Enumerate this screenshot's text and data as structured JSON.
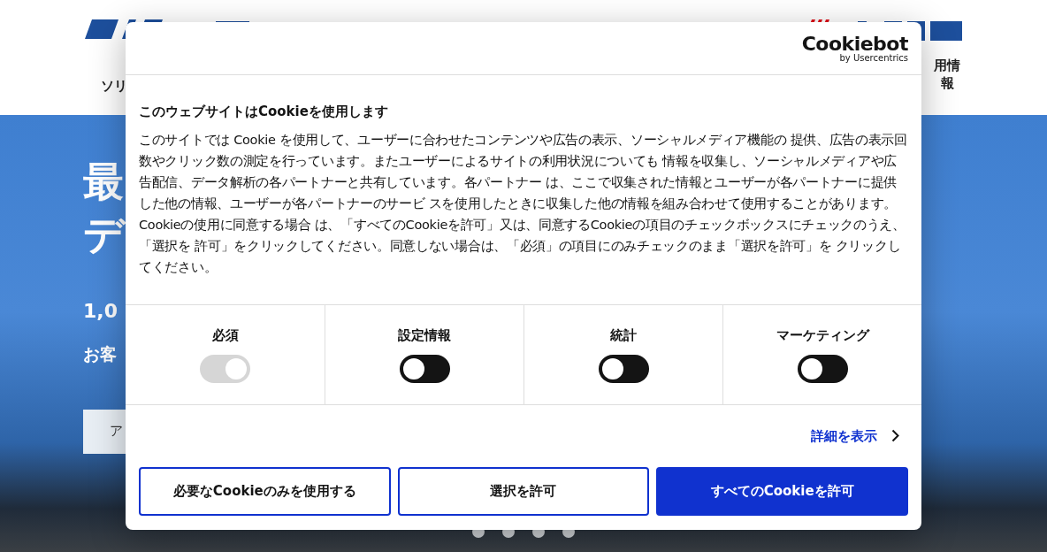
{
  "header": {
    "nav_left": "ソリ",
    "nav_right": [
      "用情",
      "報"
    ]
  },
  "hero": {
    "headline": [
      "最",
      "デ"
    ],
    "subline": "1,0",
    "caption": "お客",
    "button": "ア",
    "dots": [
      {
        "selected": false
      },
      {
        "selected": false
      },
      {
        "selected": false
      },
      {
        "selected": false
      }
    ]
  },
  "cookie_dialog": {
    "brand": "Cookiebot",
    "brand_sub": "by Usercentrics",
    "title": "このウェブサイトはCookieを使用します",
    "body": "このサイトでは Cookie を使用して、ユーザーに合わせたコンテンツや広告の表示、ソーシャルメディア機能の 提供、広告の表示回数やクリック数の測定を行っています。またユーザーによるサイトの利用状況についても 情報を収集し、ソーシャルメディアや広告配信、データ解析の各パートナーと共有しています。各パートナー は、ここで収集された情報とユーザーが各パートナーに提供した他の情報、ユーザーが各パートナーのサービ スを使用したときに収集した他の情報を組み合わせて使用することがあります。 Cookieの使用に同意する場合 は、「すべてのCookieを許可」又は、同意するCookieの項目のチェックボックスにチェックのうえ、「選択を 許可」をクリックしてください。同意しない場合は、「必須」の項目にのみチェックのまま「選択を許可」を クリックしてください。",
    "categories": [
      {
        "label": "必須",
        "checked": true,
        "disabled": true
      },
      {
        "label": "設定情報",
        "checked": false,
        "disabled": false
      },
      {
        "label": "統計",
        "checked": false,
        "disabled": false
      },
      {
        "label": "マーケティング",
        "checked": false,
        "disabled": false
      }
    ],
    "details_link": "詳細を表示",
    "buttons": [
      {
        "label": "必要なCookieのみを使用する",
        "kind": "outline"
      },
      {
        "label": "選択を許可",
        "kind": "outline"
      },
      {
        "label": "すべてのCookieを許可",
        "kind": "primary"
      }
    ]
  }
}
